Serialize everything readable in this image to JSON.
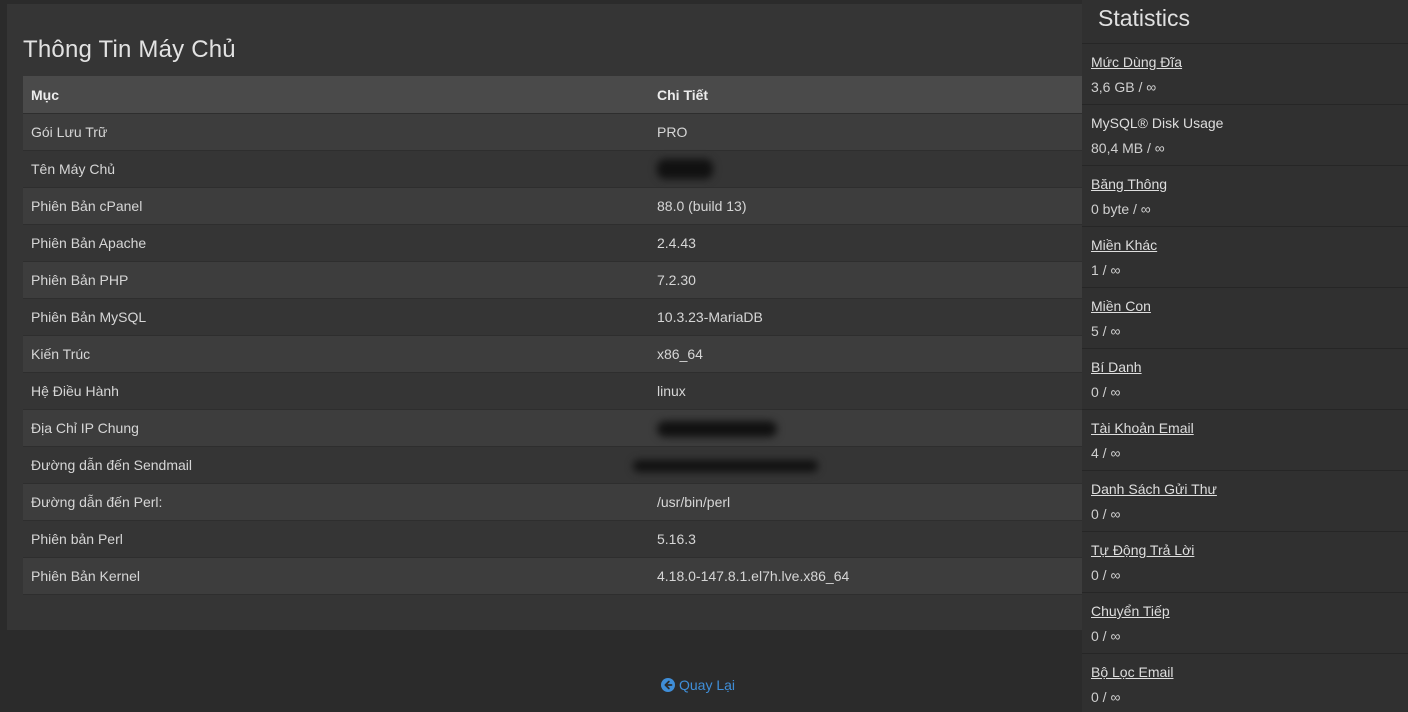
{
  "server_info": {
    "title": "Thông Tin Máy Chủ",
    "headers": {
      "item": "Mục",
      "detail": "Chi Tiết"
    },
    "rows": [
      {
        "item": "Gói Lưu Trữ",
        "detail": "PRO"
      },
      {
        "item": "Tên Máy Chủ",
        "detail": ""
      },
      {
        "item": "Phiên Bản cPanel",
        "detail": "88.0 (build 13)"
      },
      {
        "item": "Phiên Bản Apache",
        "detail": "2.4.43"
      },
      {
        "item": "Phiên Bản PHP",
        "detail": "7.2.30"
      },
      {
        "item": "Phiên Bản MySQL",
        "detail": "10.3.23-MariaDB"
      },
      {
        "item": "Kiến Trúc",
        "detail": "x86_64"
      },
      {
        "item": "Hệ Điều Hành",
        "detail": "linux"
      },
      {
        "item": "Địa Chỉ IP Chung",
        "detail": ""
      },
      {
        "item": "Đường dẫn đến Sendmail",
        "detail": ""
      },
      {
        "item": "Đường dẫn đến Perl:",
        "detail": "/usr/bin/perl"
      },
      {
        "item": "Phiên bản Perl",
        "detail": "5.16.3"
      },
      {
        "item": "Phiên Bản Kernel",
        "detail": "4.18.0-147.8.1.el7h.lve.x86_64"
      }
    ]
  },
  "back_link": {
    "label": "Quay Lại",
    "icon": "arrow-circle-left-icon",
    "color": "#3f8ed8"
  },
  "statistics": {
    "title": "Statistics",
    "items": [
      {
        "label": "Mức Dùng Đĩa",
        "value": "3,6 GB / ∞",
        "link": true
      },
      {
        "label": "MySQL® Disk Usage",
        "value": "80,4 MB / ∞",
        "link": false
      },
      {
        "label": "Băng Thông",
        "value": "0 byte / ∞",
        "link": true
      },
      {
        "label": "Miền Khác",
        "value": "1 / ∞",
        "link": true
      },
      {
        "label": "Miền Con",
        "value": "5 / ∞",
        "link": true
      },
      {
        "label": "Bí Danh",
        "value": "0 / ∞",
        "link": true
      },
      {
        "label": "Tài Khoản Email",
        "value": "4 / ∞",
        "link": true
      },
      {
        "label": "Danh Sách Gửi Thư",
        "value": "0 / ∞",
        "link": true
      },
      {
        "label": "Tự Động Trả Lời",
        "value": "0 / ∞",
        "link": true
      },
      {
        "label": "Chuyển Tiếp",
        "value": "0 / ∞",
        "link": true
      },
      {
        "label": "Bộ Lọc Email",
        "value": "0 / ∞",
        "link": true
      }
    ]
  }
}
